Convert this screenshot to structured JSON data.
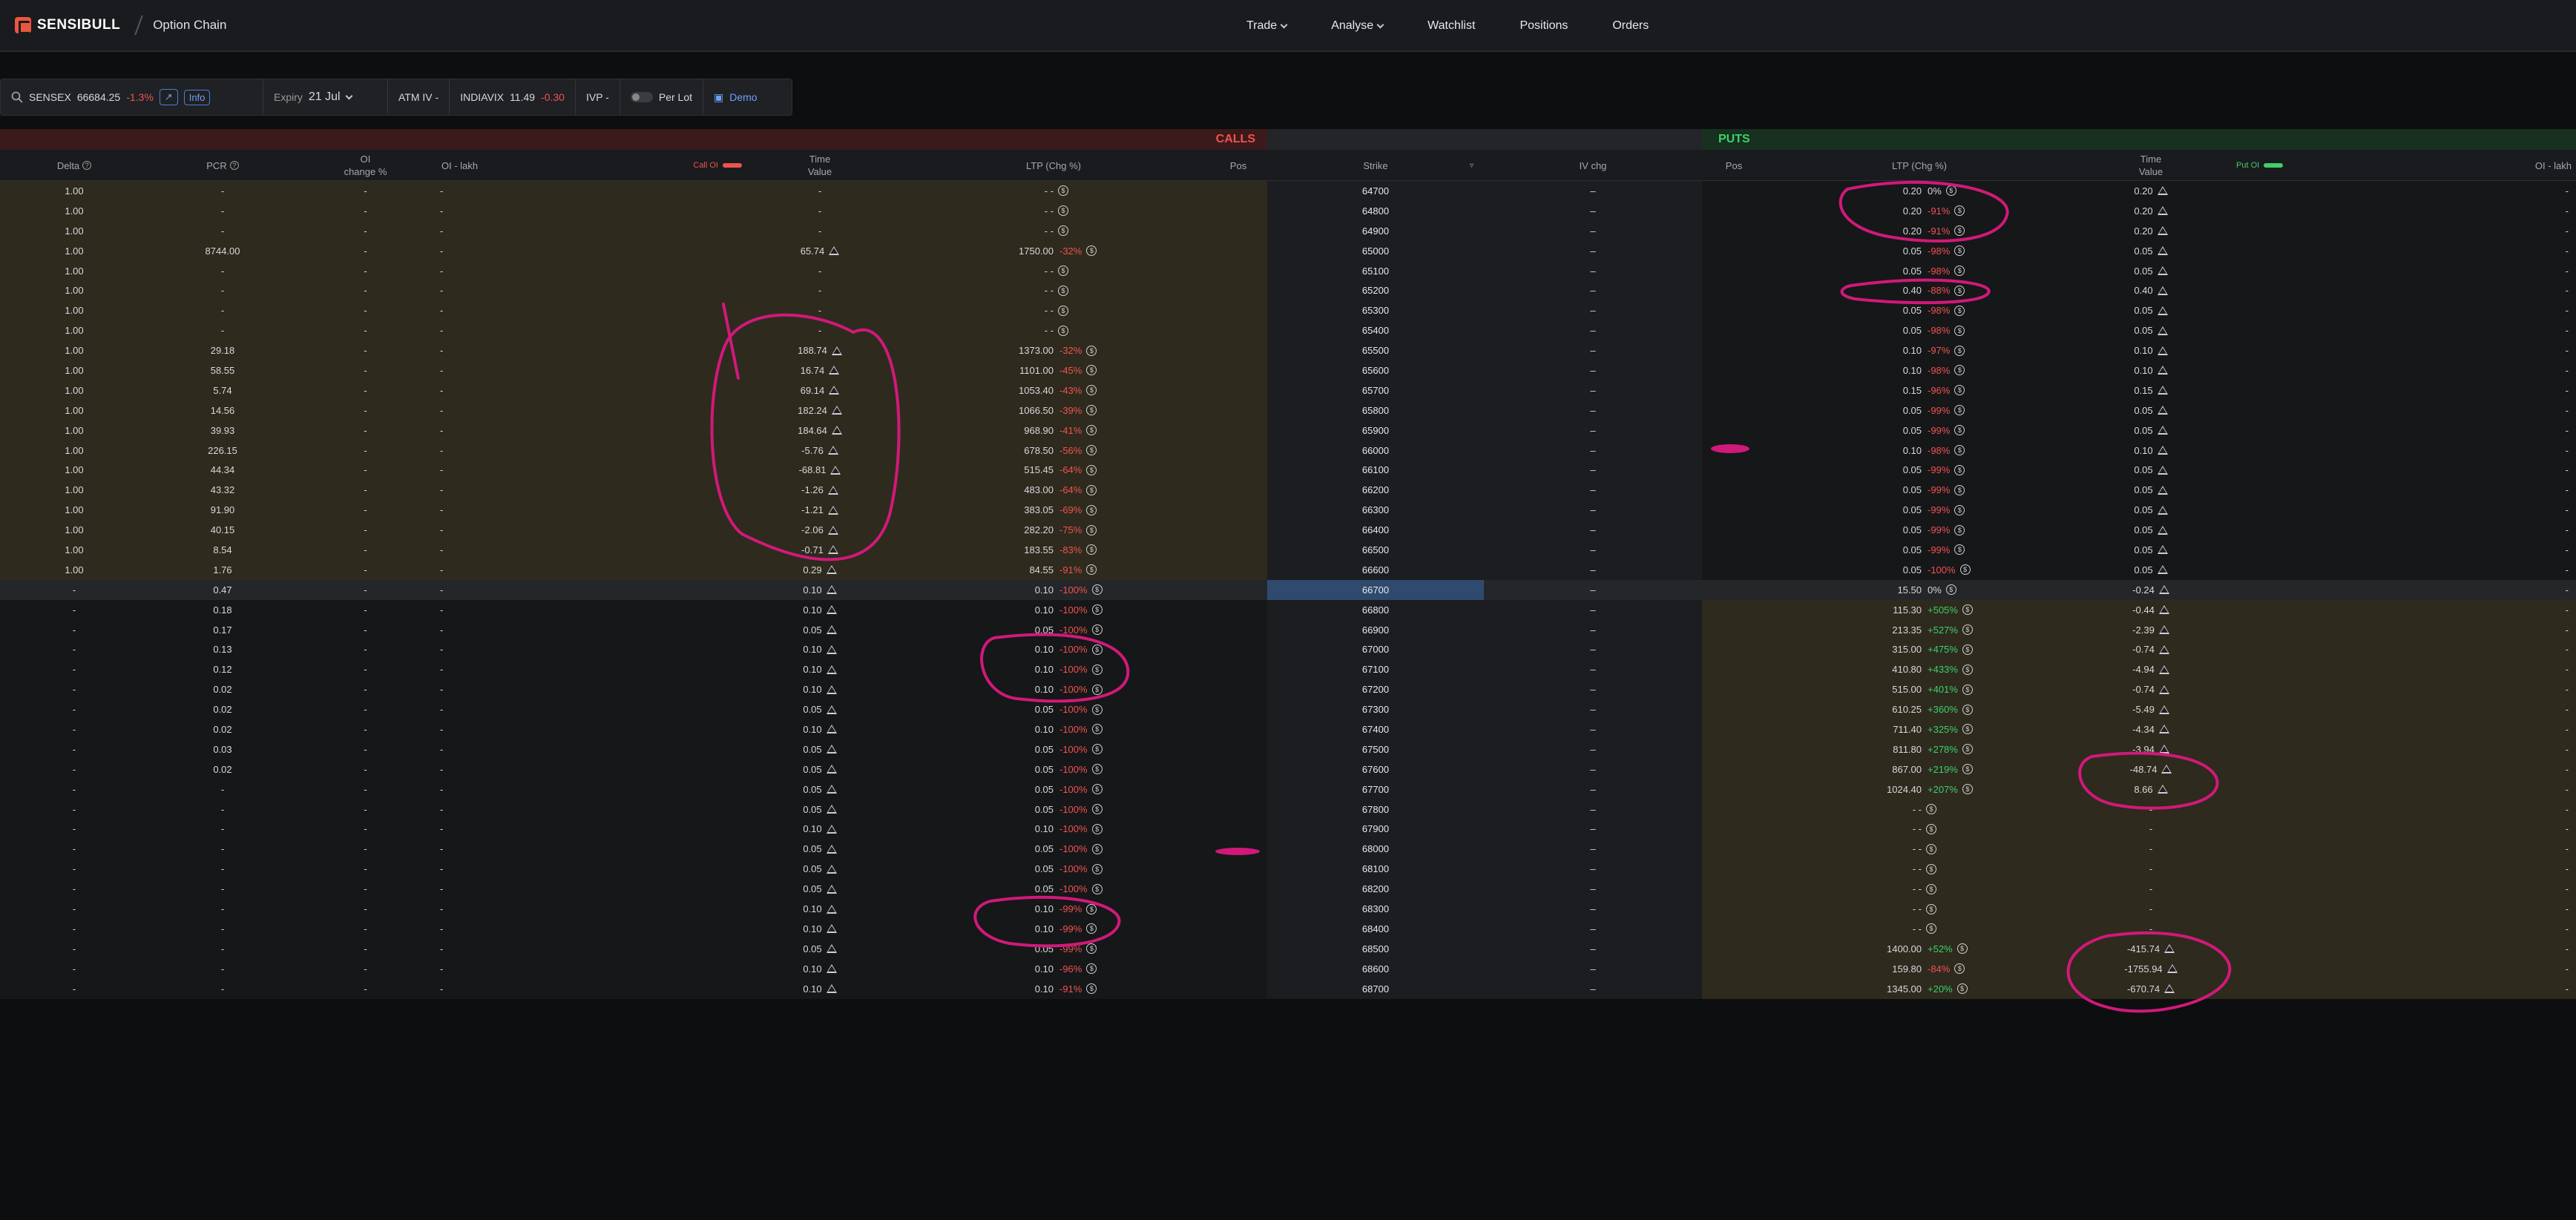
{
  "header": {
    "brand": "SENSIBULL",
    "page": "Option Chain",
    "nav": [
      {
        "label": "Trade",
        "dropdown": true
      },
      {
        "label": "Analyse",
        "dropdown": true
      },
      {
        "label": "Watchlist"
      },
      {
        "label": "Positions"
      },
      {
        "label": "Orders"
      }
    ]
  },
  "toolbar": {
    "symbol": "SENSEX",
    "spot": "66684.25",
    "spot_chg": "-1.3%",
    "info": "Info",
    "expiry_label": "Expiry",
    "expiry_value": "21 Jul",
    "atm_iv": "ATM IV -",
    "vix_label": "INDIAVIX",
    "vix_value": "11.49",
    "vix_chg": "-0.30",
    "ivp": "IVP -",
    "per_lot": "Per Lot",
    "demo": "Demo"
  },
  "bands": {
    "calls": "CALLS",
    "puts": "PUTS"
  },
  "columns": {
    "delta": "Delta",
    "pcr": "PCR",
    "oi_change_1": "OI",
    "oi_change_2": "change %",
    "oi_lakh": "OI - lakh",
    "call_oi": "Call OI",
    "time_value_1": "Time",
    "time_value_2": "Value",
    "ltp": "LTP (Chg %)",
    "pos": "Pos",
    "strike": "Strike",
    "iv_chg": "IV chg",
    "put_oi": "Put OI"
  },
  "colors": {
    "call_band": "#3a1a1b",
    "put_band": "#17301f",
    "annotation": "#d1197a",
    "negative": "#ef5350",
    "positive": "#3ecf6a"
  },
  "rows": [
    {
      "delta": "1.00",
      "pcr": "-",
      "oic": "-",
      "oil": "-",
      "ctv": "-",
      "ctvw": false,
      "cltp": "- -",
      "cchg": "",
      "strike": "64700",
      "iv": "–",
      "pltp": "0.20",
      "pchg": "0%",
      "ptv": "0.20",
      "ptvw": true,
      "poi": "-"
    },
    {
      "delta": "1.00",
      "pcr": "-",
      "oic": "-",
      "oil": "-",
      "ctv": "-",
      "ctvw": false,
      "cltp": "- -",
      "cchg": "",
      "strike": "64800",
      "iv": "–",
      "pltp": "0.20",
      "pchg": "-91%",
      "ptv": "0.20",
      "ptvw": true,
      "poi": "-"
    },
    {
      "delta": "1.00",
      "pcr": "-",
      "oic": "-",
      "oil": "-",
      "ctv": "-",
      "ctvw": false,
      "cltp": "- -",
      "cchg": "",
      "strike": "64900",
      "iv": "–",
      "pltp": "0.20",
      "pchg": "-91%",
      "ptv": "0.20",
      "ptvw": true,
      "poi": "-"
    },
    {
      "delta": "1.00",
      "pcr": "8744.00",
      "oic": "-",
      "oil": "-",
      "ctv": "65.74",
      "ctvw": true,
      "cltp": "1750.00",
      "cchg": "-32%",
      "strike": "65000",
      "iv": "–",
      "pltp": "0.05",
      "pchg": "-98%",
      "ptv": "0.05",
      "ptvw": true,
      "poi": "-"
    },
    {
      "delta": "1.00",
      "pcr": "-",
      "oic": "-",
      "oil": "-",
      "ctv": "-",
      "ctvw": false,
      "cltp": "- -",
      "cchg": "",
      "strike": "65100",
      "iv": "–",
      "pltp": "0.05",
      "pchg": "-98%",
      "ptv": "0.05",
      "ptvw": true,
      "poi": "-"
    },
    {
      "delta": "1.00",
      "pcr": "-",
      "oic": "-",
      "oil": "-",
      "ctv": "-",
      "ctvw": false,
      "cltp": "- -",
      "cchg": "",
      "strike": "65200",
      "iv": "–",
      "pltp": "0.40",
      "pchg": "-88%",
      "ptv": "0.40",
      "ptvw": true,
      "poi": "-"
    },
    {
      "delta": "1.00",
      "pcr": "-",
      "oic": "-",
      "oil": "-",
      "ctv": "-",
      "ctvw": false,
      "cltp": "- -",
      "cchg": "",
      "strike": "65300",
      "iv": "–",
      "pltp": "0.05",
      "pchg": "-98%",
      "ptv": "0.05",
      "ptvw": true,
      "poi": "-"
    },
    {
      "delta": "1.00",
      "pcr": "-",
      "oic": "-",
      "oil": "-",
      "ctv": "-",
      "ctvw": false,
      "cltp": "- -",
      "cchg": "",
      "strike": "65400",
      "iv": "–",
      "pltp": "0.05",
      "pchg": "-98%",
      "ptv": "0.05",
      "ptvw": true,
      "poi": "-"
    },
    {
      "delta": "1.00",
      "pcr": "29.18",
      "oic": "-",
      "oil": "-",
      "ctv": "188.74",
      "ctvw": true,
      "cltp": "1373.00",
      "cchg": "-32%",
      "strike": "65500",
      "iv": "–",
      "pltp": "0.10",
      "pchg": "-97%",
      "ptv": "0.10",
      "ptvw": true,
      "poi": "-"
    },
    {
      "delta": "1.00",
      "pcr": "58.55",
      "oic": "-",
      "oil": "-",
      "ctv": "16.74",
      "ctvw": true,
      "cltp": "1101.00",
      "cchg": "-45%",
      "strike": "65600",
      "iv": "–",
      "pltp": "0.10",
      "pchg": "-98%",
      "ptv": "0.10",
      "ptvw": true,
      "poi": "-"
    },
    {
      "delta": "1.00",
      "pcr": "5.74",
      "oic": "-",
      "oil": "-",
      "ctv": "69.14",
      "ctvw": true,
      "cltp": "1053.40",
      "cchg": "-43%",
      "strike": "65700",
      "iv": "–",
      "pltp": "0.15",
      "pchg": "-96%",
      "ptv": "0.15",
      "ptvw": true,
      "poi": "-"
    },
    {
      "delta": "1.00",
      "pcr": "14.56",
      "oic": "-",
      "oil": "-",
      "ctv": "182.24",
      "ctvw": true,
      "cltp": "1066.50",
      "cchg": "-39%",
      "strike": "65800",
      "iv": "–",
      "pltp": "0.05",
      "pchg": "-99%",
      "ptv": "0.05",
      "ptvw": true,
      "poi": "-"
    },
    {
      "delta": "1.00",
      "pcr": "39.93",
      "oic": "-",
      "oil": "-",
      "ctv": "184.64",
      "ctvw": true,
      "cltp": "968.90",
      "cchg": "-41%",
      "strike": "65900",
      "iv": "–",
      "pltp": "0.05",
      "pchg": "-99%",
      "ptv": "0.05",
      "ptvw": true,
      "poi": "-"
    },
    {
      "delta": "1.00",
      "pcr": "226.15",
      "oic": "-",
      "oil": "-",
      "ctv": "-5.76",
      "ctvw": true,
      "cltp": "678.50",
      "cchg": "-56%",
      "strike": "66000",
      "iv": "–",
      "pltp": "0.10",
      "pchg": "-98%",
      "ptv": "0.10",
      "ptvw": true,
      "poi": "-"
    },
    {
      "delta": "1.00",
      "pcr": "44.34",
      "oic": "-",
      "oil": "-",
      "ctv": "-68.81",
      "ctvw": true,
      "cltp": "515.45",
      "cchg": "-64%",
      "strike": "66100",
      "iv": "–",
      "pltp": "0.05",
      "pchg": "-99%",
      "ptv": "0.05",
      "ptvw": true,
      "poi": "-"
    },
    {
      "delta": "1.00",
      "pcr": "43.32",
      "oic": "-",
      "oil": "-",
      "ctv": "-1.26",
      "ctvw": true,
      "cltp": "483.00",
      "cchg": "-64%",
      "strike": "66200",
      "iv": "–",
      "pltp": "0.05",
      "pchg": "-99%",
      "ptv": "0.05",
      "ptvw": true,
      "poi": "-"
    },
    {
      "delta": "1.00",
      "pcr": "91.90",
      "oic": "-",
      "oil": "-",
      "ctv": "-1.21",
      "ctvw": true,
      "cltp": "383.05",
      "cchg": "-69%",
      "strike": "66300",
      "iv": "–",
      "pltp": "0.05",
      "pchg": "-99%",
      "ptv": "0.05",
      "ptvw": true,
      "poi": "-"
    },
    {
      "delta": "1.00",
      "pcr": "40.15",
      "oic": "-",
      "oil": "-",
      "ctv": "-2.06",
      "ctvw": true,
      "cltp": "282.20",
      "cchg": "-75%",
      "strike": "66400",
      "iv": "–",
      "pltp": "0.05",
      "pchg": "-99%",
      "ptv": "0.05",
      "ptvw": true,
      "poi": "-"
    },
    {
      "delta": "1.00",
      "pcr": "8.54",
      "oic": "-",
      "oil": "-",
      "ctv": "-0.71",
      "ctvw": true,
      "cltp": "183.55",
      "cchg": "-83%",
      "strike": "66500",
      "iv": "–",
      "pltp": "0.05",
      "pchg": "-99%",
      "ptv": "0.05",
      "ptvw": true,
      "poi": "-"
    },
    {
      "delta": "1.00",
      "pcr": "1.76",
      "oic": "-",
      "oil": "-",
      "ctv": "0.29",
      "ctvw": true,
      "cltp": "84.55",
      "cchg": "-91%",
      "strike": "66600",
      "iv": "–",
      "pltp": "0.05",
      "pchg": "-100%",
      "ptv": "0.05",
      "ptvw": true,
      "poi": "-"
    },
    {
      "delta": "-",
      "pcr": "0.47",
      "oic": "-",
      "oil": "-",
      "ctv": "0.10",
      "ctvw": true,
      "cltp": "0.10",
      "cchg": "-100%",
      "strike": "66700",
      "iv": "–",
      "pltp": "15.50",
      "pchg": "0%",
      "ptv": "-0.24",
      "ptvw": true,
      "poi": "-",
      "atm": true
    },
    {
      "delta": "-",
      "pcr": "0.18",
      "oic": "-",
      "oil": "-",
      "ctv": "0.10",
      "ctvw": true,
      "cltp": "0.10",
      "cchg": "-100%",
      "strike": "66800",
      "iv": "–",
      "pltp": "115.30",
      "pchg": "+505%",
      "ptv": "-0.44",
      "ptvw": true,
      "poi": "-"
    },
    {
      "delta": "-",
      "pcr": "0.17",
      "oic": "-",
      "oil": "-",
      "ctv": "0.05",
      "ctvw": true,
      "cltp": "0.05",
      "cchg": "-100%",
      "strike": "66900",
      "iv": "–",
      "pltp": "213.35",
      "pchg": "+527%",
      "ptv": "-2.39",
      "ptvw": true,
      "poi": "-"
    },
    {
      "delta": "-",
      "pcr": "0.13",
      "oic": "-",
      "oil": "-",
      "ctv": "0.10",
      "ctvw": true,
      "cltp": "0.10",
      "cchg": "-100%",
      "strike": "67000",
      "iv": "–",
      "pltp": "315.00",
      "pchg": "+475%",
      "ptv": "-0.74",
      "ptvw": true,
      "poi": "-"
    },
    {
      "delta": "-",
      "pcr": "0.12",
      "oic": "-",
      "oil": "-",
      "ctv": "0.10",
      "ctvw": true,
      "cltp": "0.10",
      "cchg": "-100%",
      "strike": "67100",
      "iv": "–",
      "pltp": "410.80",
      "pchg": "+433%",
      "ptv": "-4.94",
      "ptvw": true,
      "poi": "-"
    },
    {
      "delta": "-",
      "pcr": "0.02",
      "oic": "-",
      "oil": "-",
      "ctv": "0.10",
      "ctvw": true,
      "cltp": "0.10",
      "cchg": "-100%",
      "strike": "67200",
      "iv": "–",
      "pltp": "515.00",
      "pchg": "+401%",
      "ptv": "-0.74",
      "ptvw": true,
      "poi": "-"
    },
    {
      "delta": "-",
      "pcr": "0.02",
      "oic": "-",
      "oil": "-",
      "ctv": "0.05",
      "ctvw": true,
      "cltp": "0.05",
      "cchg": "-100%",
      "strike": "67300",
      "iv": "–",
      "pltp": "610.25",
      "pchg": "+360%",
      "ptv": "-5.49",
      "ptvw": true,
      "poi": "-"
    },
    {
      "delta": "-",
      "pcr": "0.02",
      "oic": "-",
      "oil": "-",
      "ctv": "0.10",
      "ctvw": true,
      "cltp": "0.10",
      "cchg": "-100%",
      "strike": "67400",
      "iv": "–",
      "pltp": "711.40",
      "pchg": "+325%",
      "ptv": "-4.34",
      "ptvw": true,
      "poi": "-"
    },
    {
      "delta": "-",
      "pcr": "0.03",
      "oic": "-",
      "oil": "-",
      "ctv": "0.05",
      "ctvw": true,
      "cltp": "0.05",
      "cchg": "-100%",
      "strike": "67500",
      "iv": "–",
      "pltp": "811.80",
      "pchg": "+278%",
      "ptv": "-3.94",
      "ptvw": true,
      "poi": "-"
    },
    {
      "delta": "-",
      "pcr": "0.02",
      "oic": "-",
      "oil": "-",
      "ctv": "0.05",
      "ctvw": true,
      "cltp": "0.05",
      "cchg": "-100%",
      "strike": "67600",
      "iv": "–",
      "pltp": "867.00",
      "pchg": "+219%",
      "ptv": "-48.74",
      "ptvw": true,
      "poi": "-"
    },
    {
      "delta": "-",
      "pcr": "-",
      "oic": "-",
      "oil": "-",
      "ctv": "0.05",
      "ctvw": true,
      "cltp": "0.05",
      "cchg": "-100%",
      "strike": "67700",
      "iv": "–",
      "pltp": "1024.40",
      "pchg": "+207%",
      "ptv": "8.66",
      "ptvw": true,
      "poi": "-"
    },
    {
      "delta": "-",
      "pcr": "-",
      "oic": "-",
      "oil": "-",
      "ctv": "0.05",
      "ctvw": true,
      "cltp": "0.05",
      "cchg": "-100%",
      "strike": "67800",
      "iv": "–",
      "pltp": "- -",
      "pchg": "",
      "ptv": "-",
      "ptvw": false,
      "poi": "-"
    },
    {
      "delta": "-",
      "pcr": "-",
      "oic": "-",
      "oil": "-",
      "ctv": "0.10",
      "ctvw": true,
      "cltp": "0.10",
      "cchg": "-100%",
      "strike": "67900",
      "iv": "–",
      "pltp": "- -",
      "pchg": "",
      "ptv": "-",
      "ptvw": false,
      "poi": "-"
    },
    {
      "delta": "-",
      "pcr": "-",
      "oic": "-",
      "oil": "-",
      "ctv": "0.05",
      "ctvw": true,
      "cltp": "0.05",
      "cchg": "-100%",
      "strike": "68000",
      "iv": "–",
      "pltp": "- -",
      "pchg": "",
      "ptv": "-",
      "ptvw": false,
      "poi": "-"
    },
    {
      "delta": "-",
      "pcr": "-",
      "oic": "-",
      "oil": "-",
      "ctv": "0.05",
      "ctvw": true,
      "cltp": "0.05",
      "cchg": "-100%",
      "strike": "68100",
      "iv": "–",
      "pltp": "- -",
      "pchg": "",
      "ptv": "-",
      "ptvw": false,
      "poi": "-"
    },
    {
      "delta": "-",
      "pcr": "-",
      "oic": "-",
      "oil": "-",
      "ctv": "0.05",
      "ctvw": true,
      "cltp": "0.05",
      "cchg": "-100%",
      "strike": "68200",
      "iv": "–",
      "pltp": "- -",
      "pchg": "",
      "ptv": "-",
      "ptvw": false,
      "poi": "-"
    },
    {
      "delta": "-",
      "pcr": "-",
      "oic": "-",
      "oil": "-",
      "ctv": "0.10",
      "ctvw": true,
      "cltp": "0.10",
      "cchg": "-99%",
      "strike": "68300",
      "iv": "–",
      "pltp": "- -",
      "pchg": "",
      "ptv": "-",
      "ptvw": false,
      "poi": "-"
    },
    {
      "delta": "-",
      "pcr": "-",
      "oic": "-",
      "oil": "-",
      "ctv": "0.10",
      "ctvw": true,
      "cltp": "0.10",
      "cchg": "-99%",
      "strike": "68400",
      "iv": "–",
      "pltp": "- -",
      "pchg": "",
      "ptv": "-",
      "ptvw": false,
      "poi": "-"
    },
    {
      "delta": "-",
      "pcr": "-",
      "oic": "-",
      "oil": "-",
      "ctv": "0.05",
      "ctvw": true,
      "cltp": "0.05",
      "cchg": "-99%",
      "strike": "68500",
      "iv": "–",
      "pltp": "1400.00",
      "pchg": "+52%",
      "ptv": "-415.74",
      "ptvw": true,
      "poi": "-"
    },
    {
      "delta": "-",
      "pcr": "-",
      "oic": "-",
      "oil": "-",
      "ctv": "0.10",
      "ctvw": true,
      "cltp": "0.10",
      "cchg": "-96%",
      "strike": "68600",
      "iv": "–",
      "pltp": "159.80",
      "pchg": "-84%",
      "ptv": "-1755.94",
      "ptvw": true,
      "poi": "-"
    },
    {
      "delta": "-",
      "pcr": "-",
      "oic": "-",
      "oil": "-",
      "ctv": "0.10",
      "ctvw": true,
      "cltp": "0.10",
      "cchg": "-91%",
      "strike": "68700",
      "iv": "–",
      "pltp": "1345.00",
      "pchg": "+20%",
      "ptv": "-670.74",
      "ptvw": true,
      "poi": "-"
    }
  ]
}
